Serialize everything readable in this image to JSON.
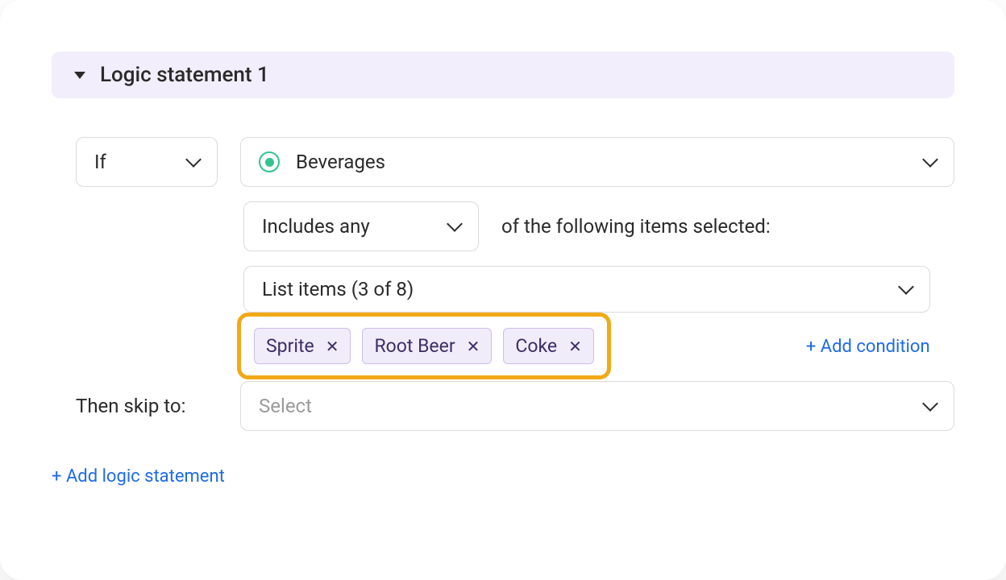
{
  "header": {
    "title": "Logic statement 1"
  },
  "condition": {
    "if_label": "If",
    "source": "Beverages",
    "match_mode": "Includes any",
    "match_suffix": "of the following items selected:",
    "list_label": "List items (3 of 8)",
    "chips": [
      "Sprite",
      "Root Beer",
      "Coke"
    ],
    "add_condition": "+ Add condition"
  },
  "then": {
    "label": "Then skip to:",
    "placeholder": "Select"
  },
  "footer": {
    "add_logic": "+ Add logic statement"
  }
}
